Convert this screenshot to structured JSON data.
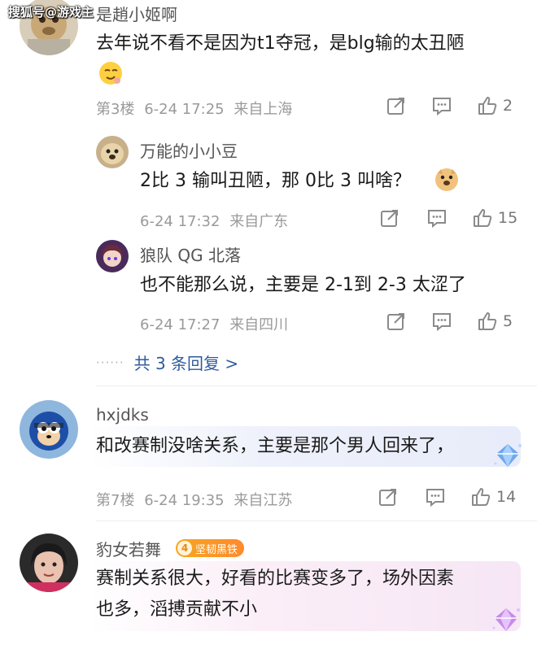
{
  "watermark": "搜狐号@游戏主",
  "comments": [
    {
      "username": "是趙小姬啊",
      "content": "去年说不看不是因为t1夺冠，是blg输的太丑陋",
      "floor": "第3楼",
      "time": "6-24 17:25",
      "location": "来自上海",
      "likes": "2",
      "replies": [
        {
          "username": "万能的小小豆",
          "content": "2比 3 输叫丑陋，那 0比 3 叫啥？",
          "time": "6-24 17:32",
          "location": "来自广东",
          "likes": "15"
        },
        {
          "username": "狼队 QG 北落",
          "content": "也不能那么说，主要是 2-1到 2-3 太涩了",
          "time": "6-24 17:27",
          "location": "来自四川",
          "likes": "5"
        }
      ],
      "more_replies": "共 3 条回复 >"
    },
    {
      "username": "hxjdks",
      "content": "和改赛制没啥关系，主要是那个男人回来了，",
      "floor": "第7楼",
      "time": "6-24 19:35",
      "location": "来自江苏",
      "likes": "14"
    },
    {
      "username": "豹女若舞",
      "badge_level": "4",
      "badge_text": "坚韧黑铁",
      "content_line1": "赛制关系很大，好看的比赛变多了，场外因素",
      "content_line2": "也多，滔搏贡献不小"
    }
  ],
  "icons": {
    "share": "share-icon",
    "comment": "comment-icon",
    "like": "thumbs-up-icon"
  },
  "colors": {
    "link": "#2f5b9c",
    "meta": "#9a9a9a",
    "badge": "#f5a623"
  }
}
